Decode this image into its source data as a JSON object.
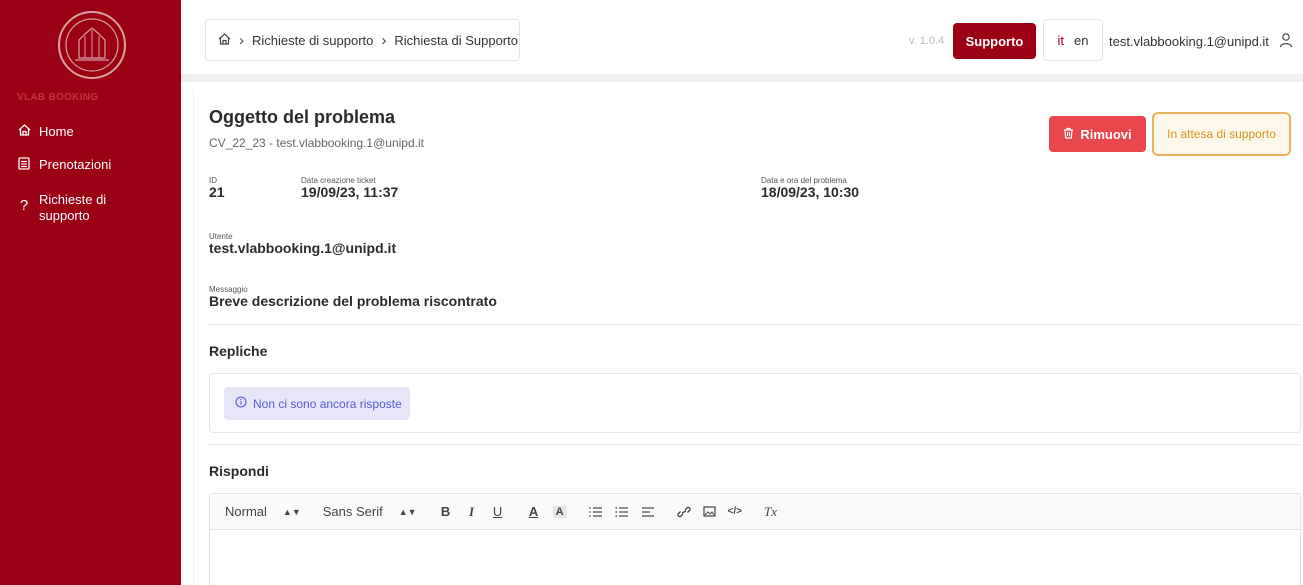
{
  "sidebar": {
    "brand": "VLAB BOOKING",
    "items": [
      {
        "label": "Home",
        "icon": "home-icon"
      },
      {
        "label": "Prenotazioni",
        "icon": "list-icon"
      },
      {
        "label": "Richieste di supporto",
        "line1": "Richieste di",
        "line2": "supporto",
        "icon": "question-icon"
      }
    ]
  },
  "header": {
    "breadcrumb": [
      "Richieste di supporto",
      "Richiesta di Supporto"
    ],
    "version": "v. 1.0.4",
    "support_label": "Supporto",
    "lang_it": "it",
    "lang_en": "en",
    "user_email": "test.vlabbooking.1@unipd.it"
  },
  "ticket": {
    "title": "Oggetto del problema",
    "subtitle": "CV_22_23 - test.vlabbooking.1@unipd.it",
    "remove_label": "Rimuovi",
    "status": "In attesa di supporto",
    "id_label": "ID",
    "id_value": "21",
    "created_label": "Data creazione ticket",
    "created_value": "19/09/23, 11:37",
    "problem_date_label": "Data e ora del problema",
    "problem_date_value": "18/09/23, 10:30",
    "user_label": "Utente",
    "user_value": "test.vlabbooking.1@unipd.it",
    "message_label": "Messaggio",
    "message_value": "Breve descrizione del problema riscontrato"
  },
  "replies": {
    "title": "Repliche",
    "empty_text": "Non ci sono ancora risposte"
  },
  "reply": {
    "title": "Rispondi",
    "toolbar": {
      "format": "Normal",
      "font": "Sans Serif",
      "bold": "B",
      "italic": "I",
      "underline": "U",
      "color": "A",
      "background": "A",
      "clear": "Tx"
    }
  },
  "colors": {
    "brand": "#9b0014",
    "danger": "#e8474e",
    "warning": "#d9921d",
    "info": "#5a5ad6"
  }
}
